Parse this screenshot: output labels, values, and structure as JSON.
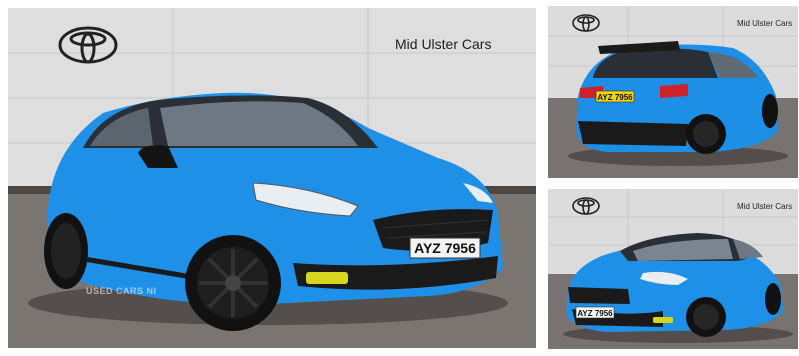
{
  "gallery": {
    "dealer_name": "Mid Ulster Cars",
    "watermark": "USED CARS NI",
    "number_plate": "AYZ 7956",
    "brand_logo": "toyota-logo",
    "images": [
      {
        "view": "front three-quarter"
      },
      {
        "view": "rear three-quarter"
      },
      {
        "view": "front three-quarter"
      }
    ],
    "colors": {
      "car_body": "#1e8fe6",
      "wall": "#dcdcdc",
      "gravel": "#7a7470",
      "trim": "#1a1a1a"
    }
  }
}
